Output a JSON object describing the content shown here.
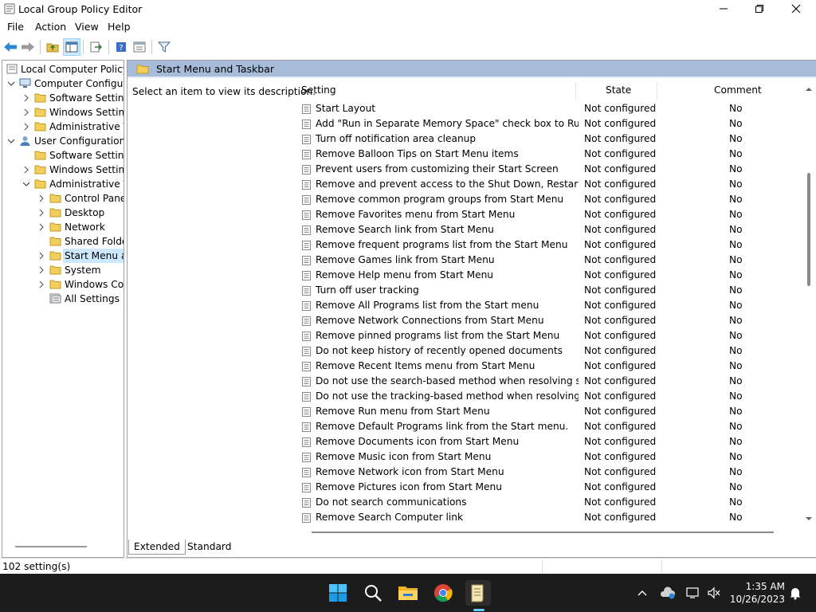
{
  "window": {
    "title": "Local Group Policy Editor",
    "controls": {
      "minimize": "minimize",
      "maximize": "restore",
      "close": "close"
    }
  },
  "menu": [
    "File",
    "Action",
    "View",
    "Help"
  ],
  "toolbar": {
    "icons": [
      "back-arrow",
      "forward-arrow",
      "up-folder",
      "show-hide-console-tree",
      "export-list",
      "help",
      "properties",
      "filter"
    ]
  },
  "tree": {
    "root": "Local Computer Policy",
    "nodes": [
      {
        "label": "Computer Configuration",
        "depth": 1,
        "expanded": true,
        "icon": "computer"
      },
      {
        "label": "Software Settings",
        "depth": 2,
        "expandable": true,
        "icon": "folder"
      },
      {
        "label": "Windows Settings",
        "depth": 2,
        "expandable": true,
        "icon": "folder"
      },
      {
        "label": "Administrative Templates",
        "depth": 2,
        "expandable": true,
        "icon": "folder"
      },
      {
        "label": "User Configuration",
        "depth": 1,
        "expanded": true,
        "icon": "user"
      },
      {
        "label": "Software Settings",
        "depth": 2,
        "expandable": false,
        "icon": "folder"
      },
      {
        "label": "Windows Settings",
        "depth": 2,
        "expandable": true,
        "icon": "folder"
      },
      {
        "label": "Administrative Templates",
        "depth": 2,
        "expanded": true,
        "icon": "folder"
      },
      {
        "label": "Control Panel",
        "depth": 3,
        "expandable": true,
        "icon": "folder"
      },
      {
        "label": "Desktop",
        "depth": 3,
        "expandable": true,
        "icon": "folder"
      },
      {
        "label": "Network",
        "depth": 3,
        "expandable": true,
        "icon": "folder"
      },
      {
        "label": "Shared Folders",
        "depth": 3,
        "expandable": false,
        "icon": "folder"
      },
      {
        "label": "Start Menu and Taskbar",
        "depth": 3,
        "expandable": true,
        "icon": "folder",
        "selected": true
      },
      {
        "label": "System",
        "depth": 3,
        "expandable": true,
        "icon": "folder"
      },
      {
        "label": "Windows Components",
        "depth": 3,
        "expandable": true,
        "icon": "folder"
      },
      {
        "label": "All Settings",
        "depth": 3,
        "expandable": false,
        "icon": "all-settings"
      }
    ]
  },
  "right_pane": {
    "header": "Start Menu and Taskbar",
    "description": "Select an item to view its description.",
    "columns": {
      "setting": "Setting",
      "state": "State",
      "comment": "Comment"
    },
    "rows": [
      {
        "setting": "Start Layout",
        "state": "Not configured",
        "comment": "No"
      },
      {
        "setting": "Add \"Run in Separate Memory Space\" check box to Run dial...",
        "state": "Not configured",
        "comment": "No"
      },
      {
        "setting": "Turn off notification area cleanup",
        "state": "Not configured",
        "comment": "No"
      },
      {
        "setting": "Remove Balloon Tips on Start Menu items",
        "state": "Not configured",
        "comment": "No"
      },
      {
        "setting": "Prevent users from customizing their Start Screen",
        "state": "Not configured",
        "comment": "No"
      },
      {
        "setting": "Remove and prevent access to the Shut Down, Restart, Sleep...",
        "state": "Not configured",
        "comment": "No"
      },
      {
        "setting": "Remove common program groups from Start Menu",
        "state": "Not configured",
        "comment": "No"
      },
      {
        "setting": "Remove Favorites menu from Start Menu",
        "state": "Not configured",
        "comment": "No"
      },
      {
        "setting": "Remove Search link from Start Menu",
        "state": "Not configured",
        "comment": "No"
      },
      {
        "setting": "Remove frequent programs list from the Start Menu",
        "state": "Not configured",
        "comment": "No"
      },
      {
        "setting": "Remove Games link from Start Menu",
        "state": "Not configured",
        "comment": "No"
      },
      {
        "setting": "Remove Help menu from Start Menu",
        "state": "Not configured",
        "comment": "No"
      },
      {
        "setting": "Turn off user tracking",
        "state": "Not configured",
        "comment": "No"
      },
      {
        "setting": "Remove All Programs list from the Start menu",
        "state": "Not configured",
        "comment": "No"
      },
      {
        "setting": "Remove Network Connections from Start Menu",
        "state": "Not configured",
        "comment": "No"
      },
      {
        "setting": "Remove pinned programs list from the Start Menu",
        "state": "Not configured",
        "comment": "No"
      },
      {
        "setting": "Do not keep history of recently opened documents",
        "state": "Not configured",
        "comment": "No"
      },
      {
        "setting": "Remove Recent Items menu from Start Menu",
        "state": "Not configured",
        "comment": "No"
      },
      {
        "setting": "Do not use the search-based method when resolving shell s...",
        "state": "Not configured",
        "comment": "No"
      },
      {
        "setting": "Do not use the tracking-based method when resolving shell ...",
        "state": "Not configured",
        "comment": "No"
      },
      {
        "setting": "Remove Run menu from Start Menu",
        "state": "Not configured",
        "comment": "No"
      },
      {
        "setting": "Remove Default Programs link from the Start menu.",
        "state": "Not configured",
        "comment": "No"
      },
      {
        "setting": "Remove Documents icon from Start Menu",
        "state": "Not configured",
        "comment": "No"
      },
      {
        "setting": "Remove Music icon from Start Menu",
        "state": "Not configured",
        "comment": "No"
      },
      {
        "setting": "Remove Network icon from Start Menu",
        "state": "Not configured",
        "comment": "No"
      },
      {
        "setting": "Remove Pictures icon from Start Menu",
        "state": "Not configured",
        "comment": "No"
      },
      {
        "setting": "Do not search communications",
        "state": "Not configured",
        "comment": "No"
      },
      {
        "setting": "Remove Search Computer link",
        "state": "Not configured",
        "comment": "No"
      }
    ]
  },
  "tabs": [
    "Extended",
    "Standard"
  ],
  "status": {
    "text": "102 setting(s)"
  },
  "taskbar": {
    "apps": [
      "start-windows",
      "search",
      "file-explorer",
      "chrome",
      "group-policy-editor"
    ],
    "tray": [
      "show-hidden-icons",
      "onedrive",
      "network",
      "volume-muted",
      "notifications"
    ],
    "time": "1:35 AM",
    "date": "10/26/2023"
  },
  "colors": {
    "header_band": "#a6bcd9",
    "selection": "#cce8ff",
    "taskbar": "#1c1c1c",
    "accent": "#60cdff"
  }
}
